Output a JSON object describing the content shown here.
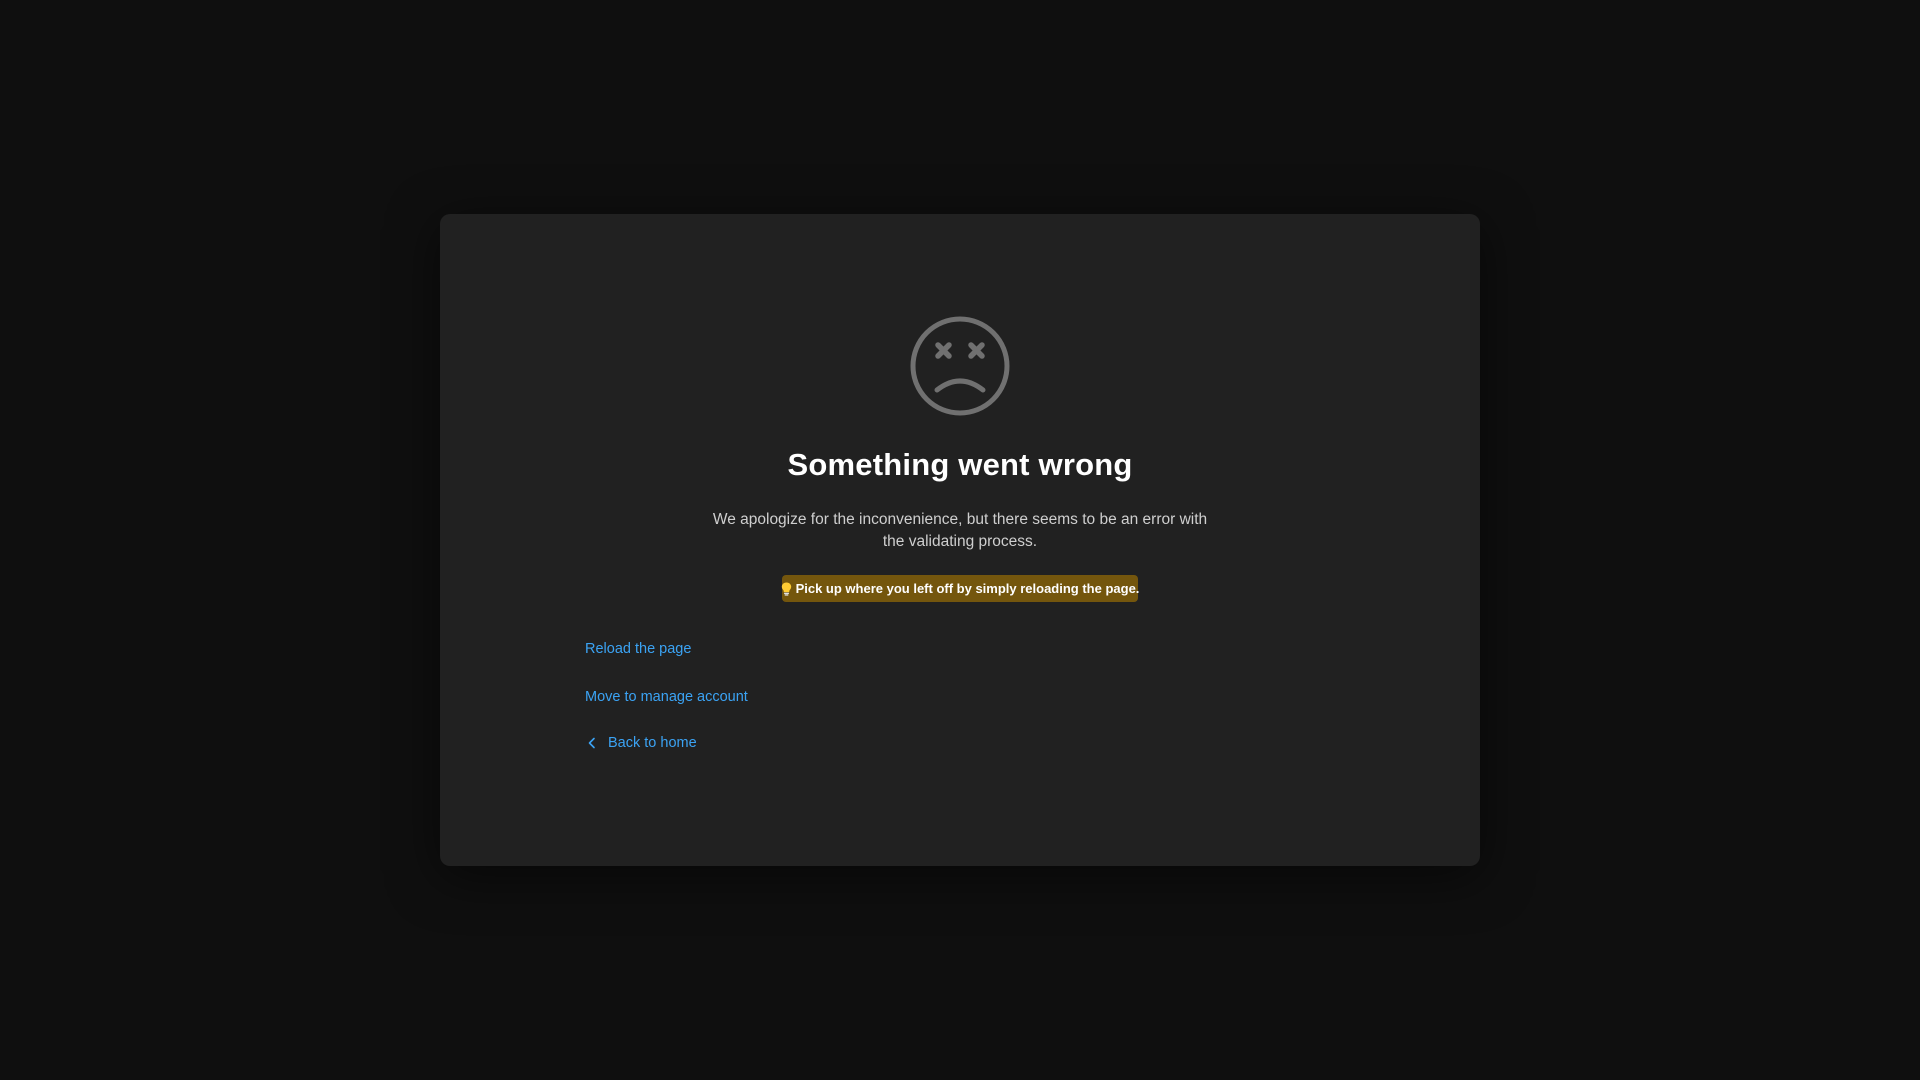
{
  "error": {
    "title": "Something went wrong",
    "description": "We apologize for the inconvenience, but there seems to be an error with the validating process.",
    "tip": "Pick up where you left off by simply reloading the page.",
    "icon": "sad-face-x-eyes-icon"
  },
  "links": {
    "reload": "Reload the page",
    "manage": "Move to manage account",
    "home": "Back to home"
  },
  "colors": {
    "background": "#0f0f0f",
    "card": "#212121",
    "link": "#3ba3f4",
    "tip_background": "#74560d",
    "icon": "#707070"
  }
}
